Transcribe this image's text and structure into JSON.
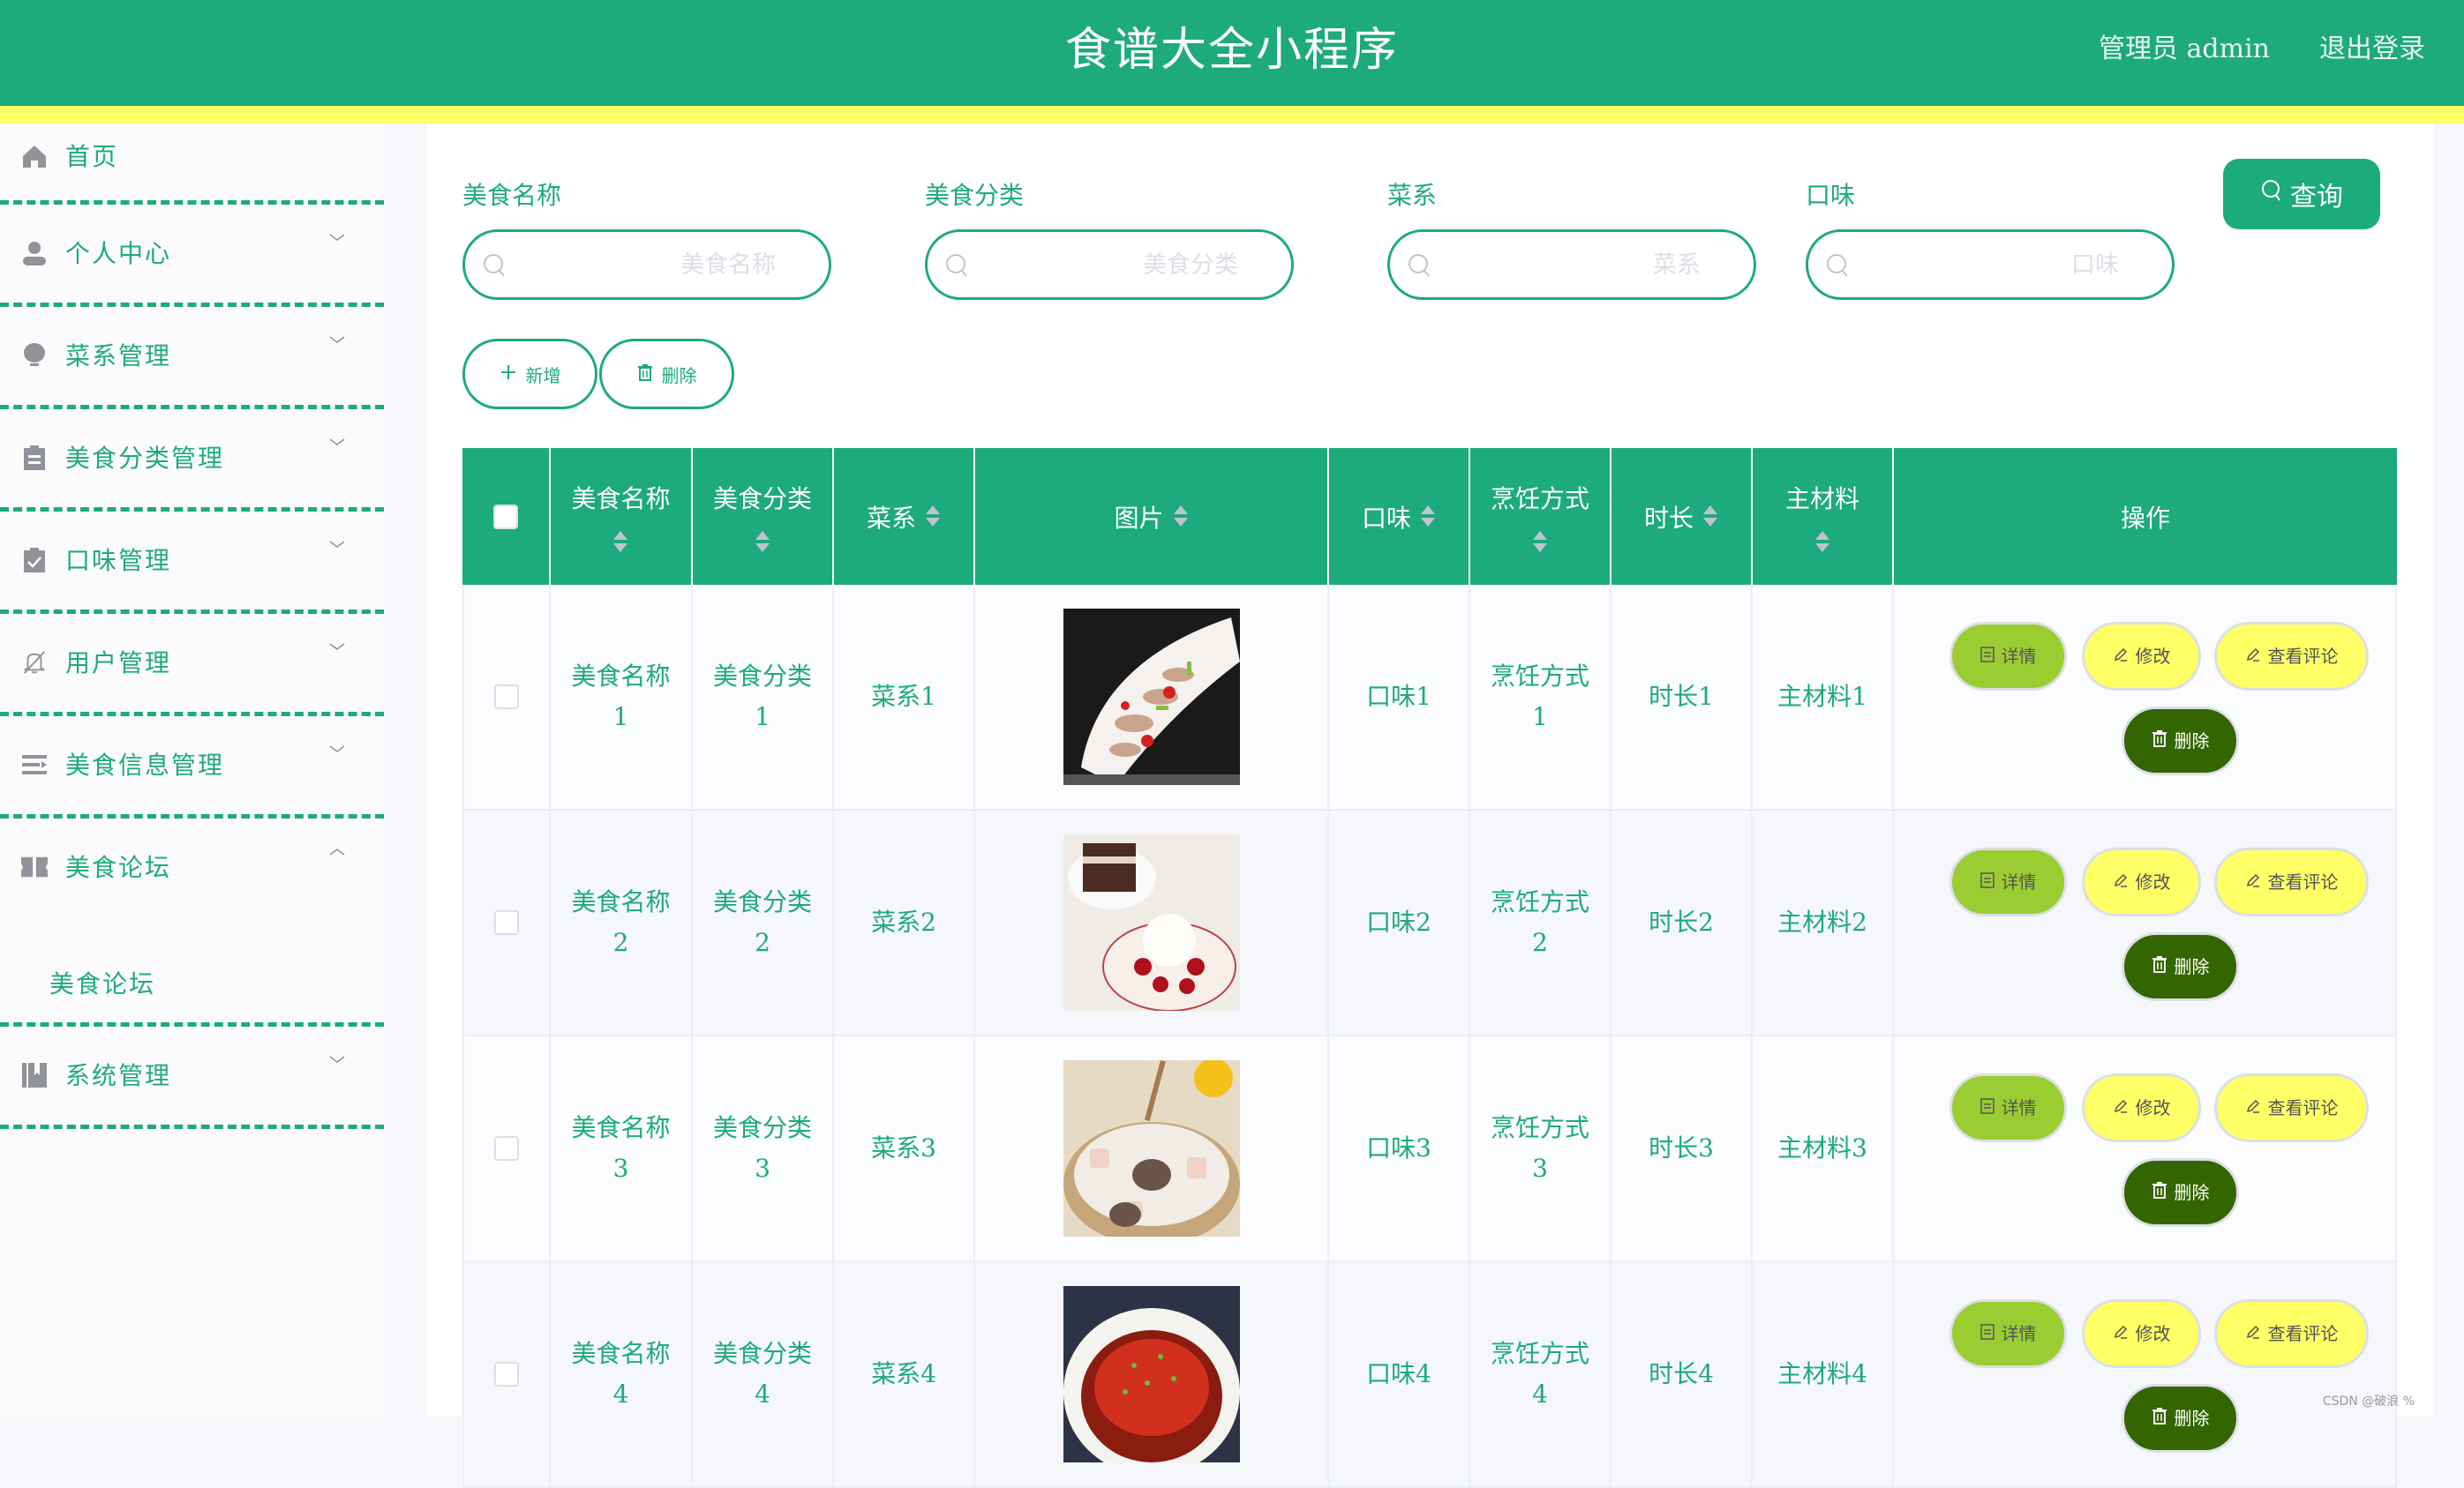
{
  "header": {
    "title": "食谱大全小程序",
    "user_label": "管理员 admin",
    "logout_label": "退出登录"
  },
  "colors": {
    "primary": "#1daa7c",
    "accent_bar": "#ffff66",
    "detail_btn": "#9acd32",
    "edit_btn": "#ffff66",
    "delete_btn": "#336600"
  },
  "sidebar": {
    "items": [
      {
        "label": "首页",
        "icon": "home-icon"
      },
      {
        "label": "个人中心",
        "icon": "user-icon"
      },
      {
        "label": "菜系管理",
        "icon": "lightbulb-icon"
      },
      {
        "label": "美食分类管理",
        "icon": "clipboard-icon"
      },
      {
        "label": "口味管理",
        "icon": "clipboard-check-icon"
      },
      {
        "label": "用户管理",
        "icon": "bell-off-icon"
      },
      {
        "label": "美食信息管理",
        "icon": "list-icon"
      },
      {
        "label": "美食论坛",
        "icon": "ticket-icon",
        "expanded": true,
        "children": [
          {
            "label": "美食论坛"
          }
        ]
      },
      {
        "label": "系统管理",
        "icon": "books-icon"
      }
    ]
  },
  "search": {
    "fields": [
      {
        "label": "美食名称",
        "placeholder": "美食名称",
        "value": ""
      },
      {
        "label": "美食分类",
        "placeholder": "美食分类",
        "value": ""
      },
      {
        "label": "菜系",
        "placeholder": "菜系",
        "value": ""
      },
      {
        "label": "口味",
        "placeholder": "口味",
        "value": ""
      }
    ],
    "query_label": "查询"
  },
  "toolbar": {
    "add_label": "新增",
    "delete_label": "删除"
  },
  "table": {
    "columns": [
      "美食名称",
      "美食分类",
      "菜系",
      "图片",
      "口味",
      "烹饪方式",
      "时长",
      "主材料",
      "操作"
    ],
    "actions": {
      "detail": "详情",
      "edit": "修改",
      "comments": "查看评论",
      "delete": "删除"
    },
    "rows": [
      {
        "name": "美食名称1",
        "category": "美食分类1",
        "cuisine": "菜系1",
        "image": "stir-fried seafood with chili on white plate",
        "flavor": "口味1",
        "method": "烹饪方式1",
        "duration": "时长1",
        "ingredient": "主材料1"
      },
      {
        "name": "美食名称2",
        "category": "美食分类2",
        "cuisine": "菜系2",
        "image": "ice cream with cherries and brownies",
        "flavor": "口味2",
        "method": "烹饪方式2",
        "duration": "时长2",
        "ingredient": "主材料2"
      },
      {
        "name": "美食名称3",
        "category": "美食分类3",
        "cuisine": "菜系3",
        "image": "lotus root and rib soup in clay pot",
        "flavor": "口味3",
        "method": "烹饪方式3",
        "duration": "时长3",
        "ingredient": "主材料3"
      },
      {
        "name": "美食名称4",
        "category": "美食分类4",
        "cuisine": "菜系4",
        "image": "steamed fish head with chopped chili",
        "flavor": "口味4",
        "method": "烹饪方式4",
        "duration": "时长4",
        "ingredient": "主材料4"
      }
    ]
  },
  "watermark": "CSDN @破浪 %"
}
